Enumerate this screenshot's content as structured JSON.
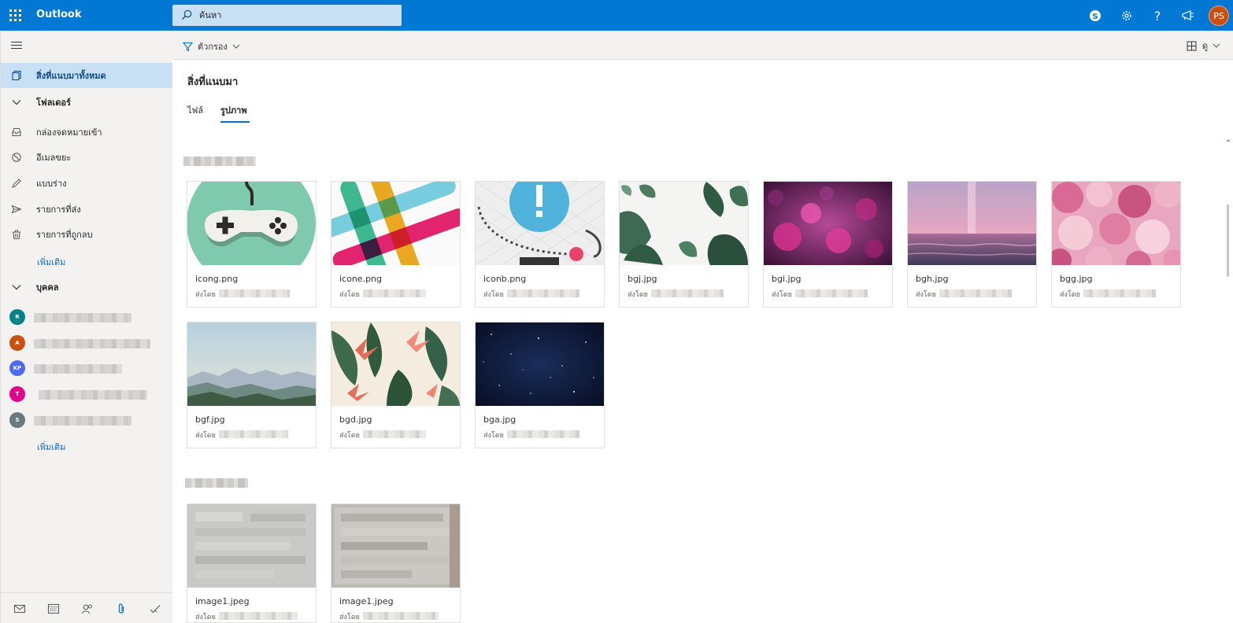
{
  "app": {
    "title": "Outlook",
    "user_initials": "PS",
    "accent": "#0078d4",
    "avatar_color": "#ca5010"
  },
  "search": {
    "placeholder": "ค้นหา",
    "icon": "search-icon"
  },
  "topbar_icons": [
    "skype-icon",
    "gear-icon",
    "help-icon",
    "megaphone-icon"
  ],
  "command_bar": {
    "filter_label": "ตัวกรอง",
    "view_label": "ดู"
  },
  "sidebar": {
    "all_attachments": "สิ่งที่แนบมาทั้งหมด",
    "folders_header": "โฟลเดอร์",
    "folders": [
      {
        "label": "กล่องจดหมายเข้า",
        "icon": "inbox-icon"
      },
      {
        "label": "อีเมลขยะ",
        "icon": "junk-icon"
      },
      {
        "label": "แบบร่าง",
        "icon": "pencil-icon"
      },
      {
        "label": "รายการที่ส่ง",
        "icon": "send-icon"
      },
      {
        "label": "รายการที่ถูกลบ",
        "icon": "trash-icon"
      }
    ],
    "folders_more": "เพิ่มเติม",
    "people_header": "บุคคล",
    "people": [
      {
        "initials": "R",
        "color": "#038387"
      },
      {
        "initials": "A",
        "color": "#ca5010"
      },
      {
        "initials": "KP",
        "color": "#4f6bed"
      },
      {
        "initials": "T",
        "color": "#e3008c"
      },
      {
        "initials": "S",
        "color": "#69797e"
      }
    ],
    "people_more": "เพิ่มเติม",
    "bottom_nav": [
      "mail-icon",
      "calendar-icon",
      "people-icon",
      "paperclip-icon",
      "todo-check-icon"
    ]
  },
  "main": {
    "title": "สิ่งที่แนบมา",
    "tabs": [
      {
        "label": "ไฟล์",
        "active": false
      },
      {
        "label": "รูปภาพ",
        "active": true
      }
    ],
    "sent_by_label": "ส่งโดย",
    "files": [
      {
        "name": "icong.png",
        "thumb": "gamepad"
      },
      {
        "name": "icone.png",
        "thumb": "slack"
      },
      {
        "name": "iconb.png",
        "thumb": "alert"
      },
      {
        "name": "bgj.jpg",
        "thumb": "leaves-white"
      },
      {
        "name": "bgi.jpg",
        "thumb": "pink-flowers"
      },
      {
        "name": "bgh.jpg",
        "thumb": "pink-sea"
      },
      {
        "name": "bgg.jpg",
        "thumb": "roses"
      },
      {
        "name": "bgf.jpg",
        "thumb": "mountains"
      },
      {
        "name": "bgd.jpg",
        "thumb": "tropical"
      },
      {
        "name": "bga.jpg",
        "thumb": "space"
      },
      {
        "name": "image1.jpeg",
        "thumb": "document"
      },
      {
        "name": "image1.jpeg",
        "thumb": "document"
      }
    ]
  }
}
